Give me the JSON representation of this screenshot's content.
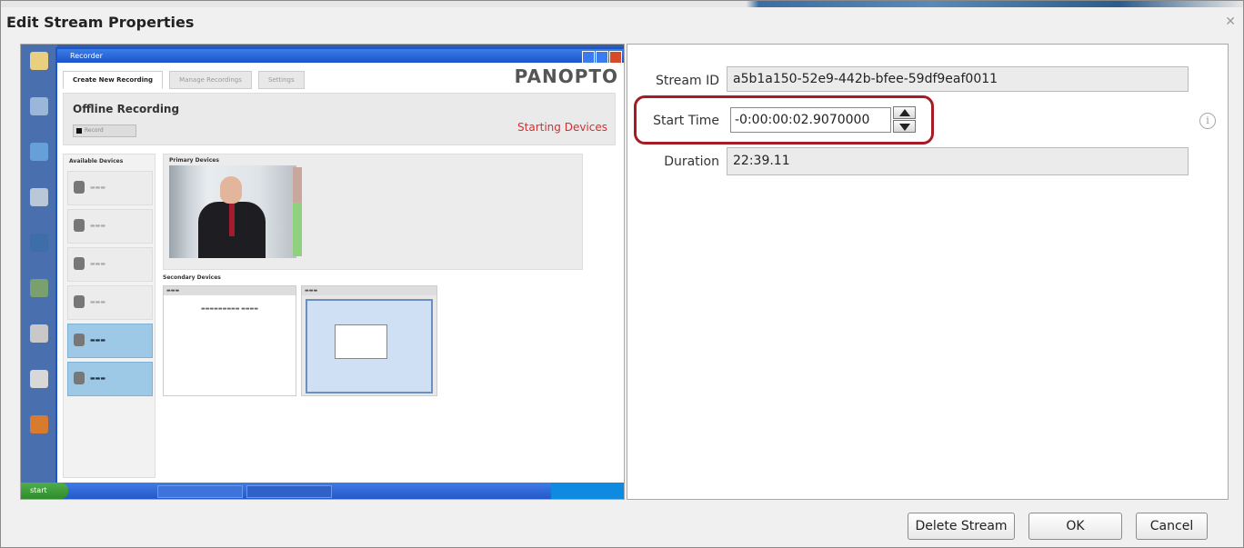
{
  "dialog": {
    "title": "Edit Stream Properties",
    "close_icon": "close-icon"
  },
  "preview": {
    "window_title": "Recorder",
    "tabs": [
      "Create New Recording",
      "Manage Recordings",
      "Settings"
    ],
    "brand": "PANOPTO",
    "offline_title": "Offline Recording",
    "record_button": "Record",
    "status": "Starting Devices",
    "available_devices_heading": "Available Devices",
    "primary_devices_heading": "Primary Devices",
    "secondary_devices_heading": "Secondary Devices",
    "start_button": "start"
  },
  "fields": {
    "stream_id_label": "Stream ID",
    "stream_id_value": "a5b1a150-52e9-442b-bfee-59df9eaf0011",
    "start_time_label": "Start Time",
    "start_time_value": "-0:00:00:02.9070000",
    "duration_label": "Duration",
    "duration_value": "22:39.11"
  },
  "info_icon": "info-icon",
  "buttons": {
    "delete": "Delete Stream",
    "ok": "OK",
    "cancel": "Cancel"
  },
  "colors": {
    "highlight": "#a51c24",
    "xp_blue": "#1b55c9",
    "status_red": "#d32f2f"
  }
}
